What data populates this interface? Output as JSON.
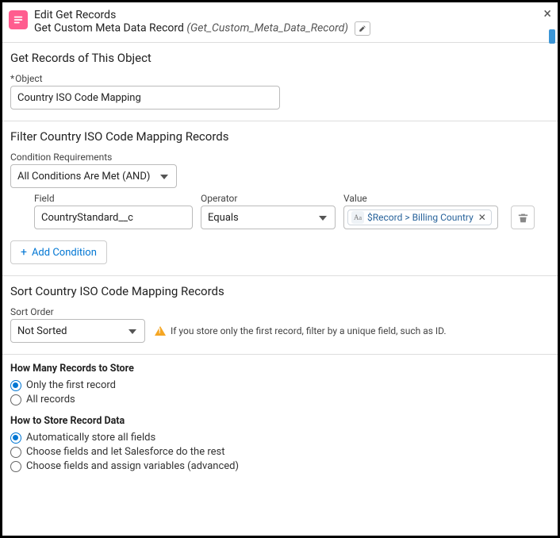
{
  "header": {
    "title": "Edit Get Records",
    "sub_label": "Get Custom Meta Data Record",
    "api_name": "(Get_Custom_Meta_Data_Record)"
  },
  "object_section": {
    "title": "Get Records of This Object",
    "object_label": "Object",
    "object_value": "Country ISO Code Mapping"
  },
  "filter_section": {
    "title": "Filter Country ISO Code Mapping Records",
    "cond_label": "Condition Requirements",
    "cond_value": "All Conditions Are Met (AND)",
    "field_label": "Field",
    "field_value": "CountryStandard__c",
    "op_label": "Operator",
    "op_value": "Equals",
    "val_label": "Value",
    "val_value": "$Record > Billing Country",
    "add_label": "Add Condition"
  },
  "sort_section": {
    "title": "Sort Country ISO Code Mapping Records",
    "sort_label": "Sort Order",
    "sort_value": "Not Sorted",
    "warning": "If you store only the first record, filter by a unique field, such as ID."
  },
  "store_section": {
    "how_many_title": "How Many Records to Store",
    "opt_first": "Only the first record",
    "opt_all": "All records",
    "how_store_title": "How to Store Record Data",
    "opt_auto": "Automatically store all fields",
    "opt_choose_rest": "Choose fields and let Salesforce do the rest",
    "opt_choose_adv": "Choose fields and assign variables (advanced)"
  }
}
